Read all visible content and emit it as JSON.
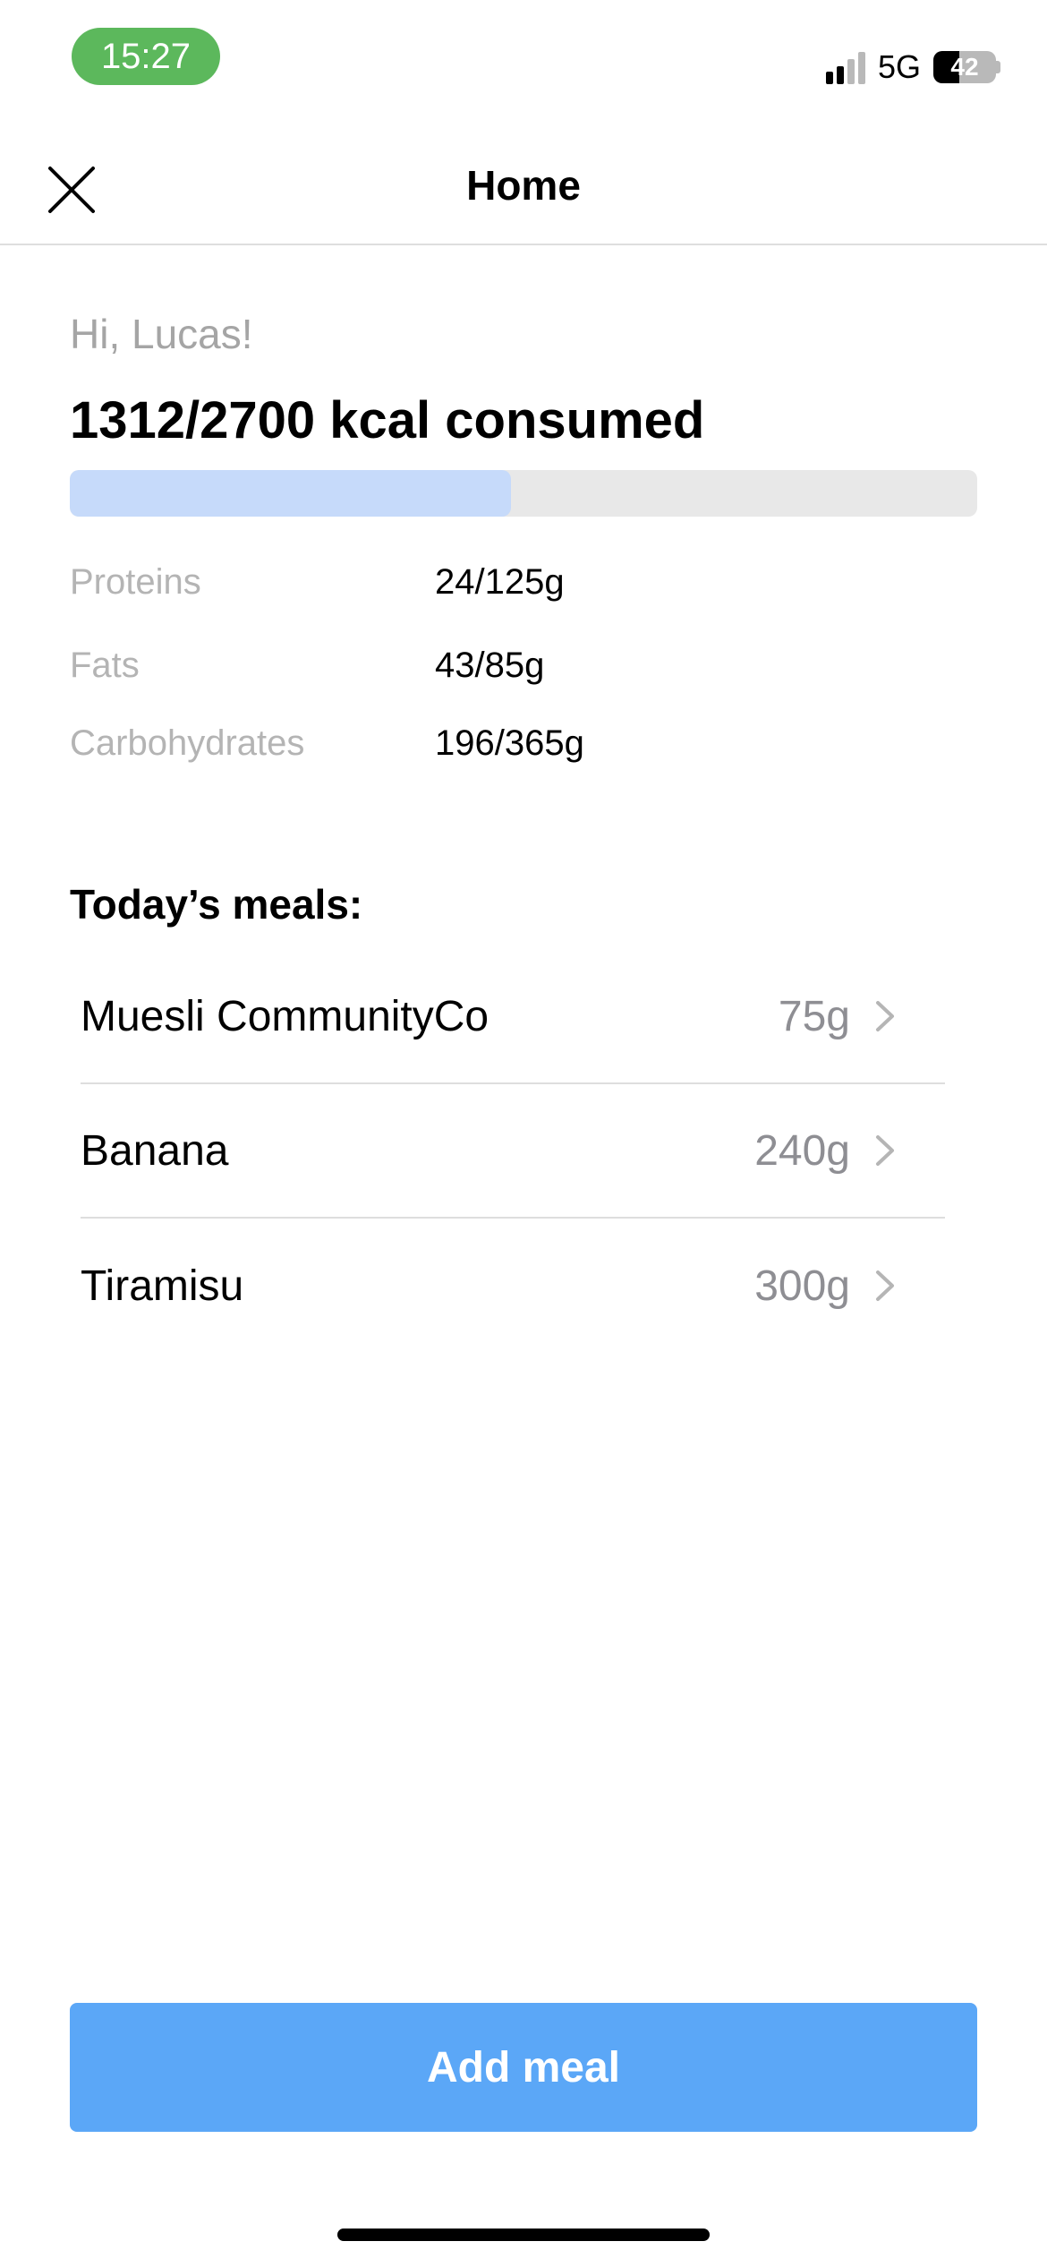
{
  "status_bar": {
    "time": "15:27",
    "network": "5G",
    "battery": "42",
    "battery_level": 0.42
  },
  "header": {
    "title": "Home",
    "close_icon": "close-icon"
  },
  "summary": {
    "greeting": "Hi, Lucas!",
    "calories_text": "1312/2700 kcal consumed",
    "calories_consumed": 1312,
    "calories_goal": 2700,
    "progress_fill_color": "#c6dafa",
    "progress_track_color": "#e8e8e8"
  },
  "macros": [
    {
      "label": "Proteins",
      "value": "24/125g"
    },
    {
      "label": "Fats",
      "value": "43/85g"
    },
    {
      "label": "Carbohydrates",
      "value": "196/365g"
    }
  ],
  "meals": {
    "title": "Today’s meals:",
    "items": [
      {
        "name": "Muesli CommunityCo",
        "weight": "75g",
        "icon": "chevron-right-icon"
      },
      {
        "name": "Banana",
        "weight": "240g",
        "icon": "chevron-right-icon"
      },
      {
        "name": "Tiramisu",
        "weight": "300g",
        "icon": "chevron-right-icon"
      }
    ]
  },
  "actions": {
    "add_meal_label": "Add meal",
    "accent_color": "#5ba7f7"
  }
}
